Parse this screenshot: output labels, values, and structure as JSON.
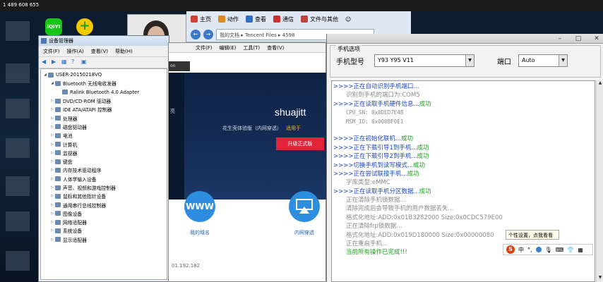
{
  "topbar": {
    "number": "1 489 608 655"
  },
  "iqiyi": {
    "label": "iQIYI"
  },
  "device_manager": {
    "title": "设备管理器",
    "menu": [
      "文件(F)",
      "操作(A)",
      "查看(V)",
      "帮助(H)"
    ],
    "tree": [
      {
        "label": "USER-20150218VQ",
        "level": 0,
        "expanded": true
      },
      {
        "label": "Bluetooth 无线电收发器",
        "level": 1,
        "expanded": true
      },
      {
        "label": "Ralink Bluetooth 4.0 Adapter",
        "level": 2,
        "expanded": false
      },
      {
        "label": "DVD/CD-ROM 驱动器",
        "level": 1,
        "expanded": false
      },
      {
        "label": "IDE ATA/ATAPI 控制器",
        "level": 1,
        "expanded": false
      },
      {
        "label": "处理器",
        "level": 1,
        "expanded": false
      },
      {
        "label": "磁盘驱动器",
        "level": 1,
        "expanded": false
      },
      {
        "label": "电池",
        "level": 1,
        "expanded": false
      },
      {
        "label": "计算机",
        "level": 1,
        "expanded": false
      },
      {
        "label": "监视器",
        "level": 1,
        "expanded": false
      },
      {
        "label": "键盘",
        "level": 1,
        "expanded": false
      },
      {
        "label": "内存技术驱动程序",
        "level": 1,
        "expanded": false
      },
      {
        "label": "人体学输入设备",
        "level": 1,
        "expanded": false
      },
      {
        "label": "声音、视频和游戏控制器",
        "level": 1,
        "expanded": false
      },
      {
        "label": "鼠标和其他指针设备",
        "level": 1,
        "expanded": false
      },
      {
        "label": "通用串行总线控制器",
        "level": 1,
        "expanded": false
      },
      {
        "label": "图像设备",
        "level": 1,
        "expanded": false
      },
      {
        "label": "网络适配器",
        "level": 1,
        "expanded": false
      },
      {
        "label": "系统设备",
        "level": 1,
        "expanded": false
      },
      {
        "label": "显示适配器",
        "level": 1,
        "expanded": false
      }
    ]
  },
  "explorer": {
    "toolbar": [
      "主页",
      "动作",
      "查看",
      "通信",
      "文件与其他"
    ],
    "breadcrumb": "我的文档 ▸ Tencent Files ▸ 4598"
  },
  "tencent": {
    "menu": [
      "文件(F)",
      "编辑(E)",
      "工具(T)",
      "查看(V)"
    ],
    "strip_text": "on",
    "side_label": "亮",
    "username": "shuajitt",
    "subtitle": "花生壳体验版（内网穿透）",
    "subtitle_link": "适用于",
    "upgrade_button": "升级正式版",
    "items": [
      {
        "icon_text": "WWW",
        "label": "我的域名"
      },
      {
        "icon_text": "",
        "label": "内网穿透"
      }
    ],
    "ip": "01.192.182"
  },
  "tool": {
    "group_title": "手机选项",
    "model_label": "手机型号",
    "model_value": "Y93 Y95 V11",
    "port_label": "端口",
    "port_value": "Auto",
    "log": [
      {
        "kind": "prompt",
        "text": ">>>>正在自动识别手机端口...",
        "suffix": ""
      },
      {
        "kind": "sub",
        "text": "识别到手机的端口为:COM5"
      },
      {
        "kind": "prompt",
        "text": ">>>>正在读取手机硬件信息...",
        "suffix": "成功"
      },
      {
        "kind": "mono",
        "text": "CPU_SN:  0x0DED7E48"
      },
      {
        "kind": "mono",
        "text": "MSM_ID:  0x000BF0E1"
      },
      {
        "kind": "blank",
        "text": ""
      },
      {
        "kind": "prompt",
        "text": ">>>>正在初始化联机...",
        "suffix": "成功"
      },
      {
        "kind": "prompt",
        "text": ">>>>正在下载引导1到手机...",
        "suffix": "成功"
      },
      {
        "kind": "prompt",
        "text": ">>>>正在下载引导2到手机...",
        "suffix": "成功"
      },
      {
        "kind": "prompt",
        "text": ">>>>切换手机到读写模式...",
        "suffix": "成功"
      },
      {
        "kind": "prompt",
        "text": ">>>>正在尝试联接手机...",
        "suffix": "成功"
      },
      {
        "kind": "sub",
        "text": "字库类型:eMMC"
      },
      {
        "kind": "prompt",
        "text": ">>>>正在读取手机分区数据...",
        "suffix": "成功"
      },
      {
        "kind": "sub",
        "text": "正在清除手机锁数据..."
      },
      {
        "kind": "sub",
        "text": "清除完成后会导致手机的用户数据丢失..."
      },
      {
        "kind": "sub",
        "text": "格式化地址:ADD:0x01B3282000   Size:0x0CDC579E00"
      },
      {
        "kind": "sub",
        "text": "正在清除frp锁数据..."
      },
      {
        "kind": "sub",
        "text": "格式化地址:ADD:0x019D180000   Size:0x00000080"
      },
      {
        "kind": "sub",
        "text": "正在重启手机..."
      },
      {
        "kind": "final",
        "text": "当前所有操作已完成!!!"
      }
    ]
  },
  "ime": {
    "tooltip": "个性设置，点我看看",
    "logo": "S",
    "mode": "中",
    "punct": "°,"
  },
  "colors": {
    "prompt_blue": "#1e46c8",
    "success_green": "#18a018",
    "tencent_red": "#e12438",
    "tencent_navy": "#152c55"
  }
}
